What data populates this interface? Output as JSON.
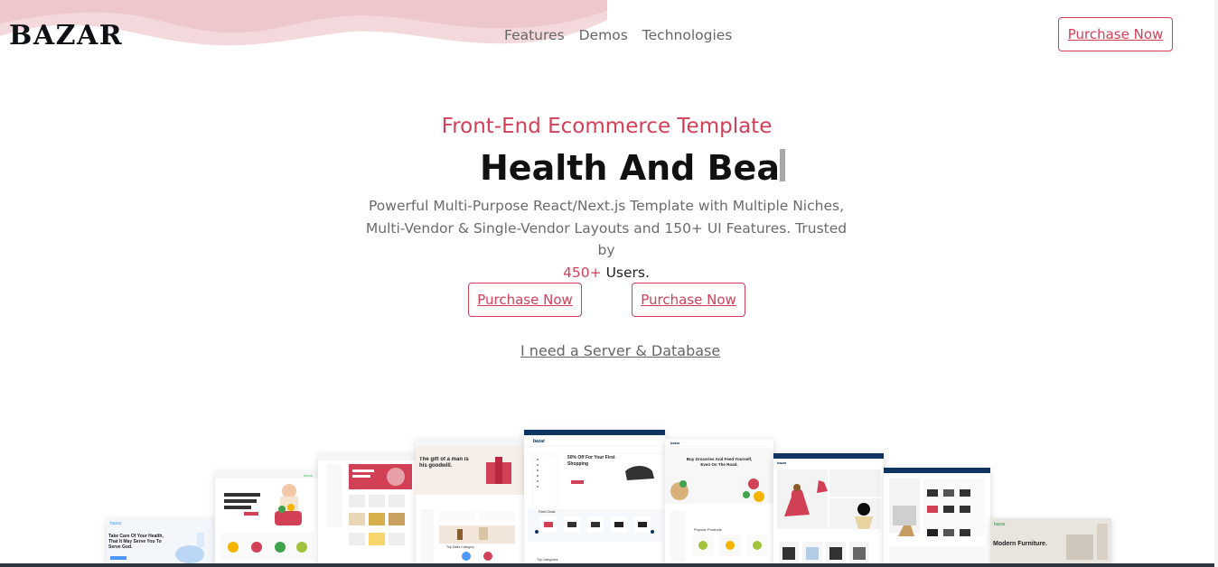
{
  "header": {
    "logo": "BAZAR",
    "nav": [
      {
        "label": "Features"
      },
      {
        "label": "Demos"
      },
      {
        "label": "Technologies"
      }
    ],
    "purchase_label": "Purchase Now"
  },
  "hero": {
    "eyebrow": "Front-End Ecommerce Template",
    "headline": "Health And Bea",
    "description": "Powerful Multi-Purpose React/Next.js Template with Multiple Niches, Multi-Vendor & Single-Vendor Layouts and 150+ UI Features. Trusted by",
    "users_count": "450+",
    "users_label": "Users.",
    "primary_button": "Purchase Now",
    "secondary_button": "Purchase Now",
    "server_link": "I need a Server & Database"
  },
  "showcase": {
    "screens": [
      {
        "brand": "bazar",
        "title": "Take Care Of Your Health, That It May Serve You To Serve God."
      },
      {
        "title": "50% Off For Your First Shopping"
      },
      {
        "title": "The gift of a man is his goodwill."
      },
      {
        "title": "Buy Groceries And Feed Yourself, Even On The Road."
      },
      {
        "brand": "bazar",
        "title": "Modern Furniture."
      }
    ]
  },
  "colors": {
    "accent": "#d23f57",
    "dark_text": "#111111",
    "muted_text": "#6b6b6b",
    "blob": "#efcfd3"
  }
}
